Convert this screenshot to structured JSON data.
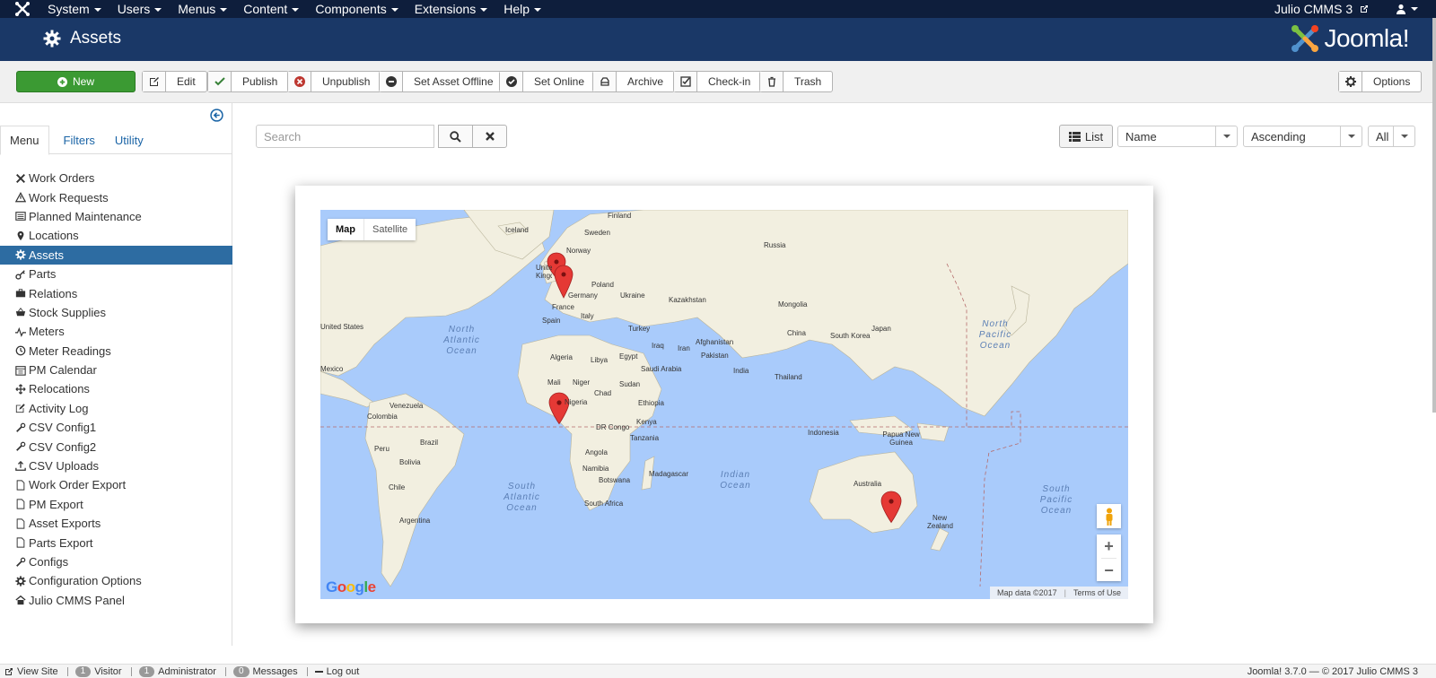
{
  "topbar": {
    "menu": [
      "System",
      "Users",
      "Menus",
      "Content",
      "Components",
      "Extensions",
      "Help"
    ],
    "site_link": "Julio CMMS 3"
  },
  "header": {
    "title": "Assets",
    "brand": "Joomla!"
  },
  "toolbar": {
    "new": "New",
    "edit": "Edit",
    "publish": "Publish",
    "unpublish": "Unpublish",
    "offline": "Set Asset Offline",
    "online": "Set Online",
    "archive": "Archive",
    "checkin": "Check-in",
    "trash": "Trash",
    "options": "Options"
  },
  "sidebar": {
    "tabs": [
      "Menu",
      "Filters",
      "Utility"
    ],
    "items": [
      {
        "label": "Work Orders",
        "icon": "tools-icon"
      },
      {
        "label": "Work Requests",
        "icon": "warning-icon"
      },
      {
        "label": "Planned Maintenance",
        "icon": "list-icon"
      },
      {
        "label": "Locations",
        "icon": "pin-icon"
      },
      {
        "label": "Assets",
        "icon": "gear-icon"
      },
      {
        "label": "Parts",
        "icon": "key-icon"
      },
      {
        "label": "Relations",
        "icon": "briefcase-icon"
      },
      {
        "label": "Stock Supplies",
        "icon": "basket-icon"
      },
      {
        "label": "Meters",
        "icon": "pulse-icon"
      },
      {
        "label": "Meter Readings",
        "icon": "clock-icon"
      },
      {
        "label": "PM Calendar",
        "icon": "calendar-icon"
      },
      {
        "label": "Relocations",
        "icon": "move-icon"
      },
      {
        "label": "Activity Log",
        "icon": "edit-icon"
      },
      {
        "label": "CSV Config1",
        "icon": "wrench-icon"
      },
      {
        "label": "CSV Config2",
        "icon": "wrench-icon"
      },
      {
        "label": "CSV Uploads",
        "icon": "upload-icon"
      },
      {
        "label": "Work Order Export",
        "icon": "file-icon"
      },
      {
        "label": "PM Export",
        "icon": "file-icon"
      },
      {
        "label": "Asset Exports",
        "icon": "file-icon"
      },
      {
        "label": "Parts Export",
        "icon": "file-icon"
      },
      {
        "label": "Configs",
        "icon": "wrench-icon"
      },
      {
        "label": "Configuration Options",
        "icon": "gear-icon"
      },
      {
        "label": "Julio CMMS Panel",
        "icon": "home-icon"
      }
    ],
    "active_index": 4
  },
  "search": {
    "placeholder": "Search"
  },
  "view": {
    "list_label": "List",
    "sort_field": "Name",
    "sort_dir": "Ascending",
    "limit": "All"
  },
  "map": {
    "type_map": "Map",
    "type_satellite": "Satellite",
    "attribution": "Map data ©2017",
    "terms": "Terms of Use",
    "google": "Google",
    "labels": {
      "iceland": "Iceland",
      "finland": "Finland",
      "sweden": "Sweden",
      "norway": "Norway",
      "russia": "Russia",
      "united_kingdom": "United Kingdom",
      "germany": "Germany",
      "poland": "Poland",
      "ukraine": "Ukraine",
      "kazakhstan": "Kazakhstan",
      "mongolia": "Mongolia",
      "france": "France",
      "italy": "Italy",
      "spain": "Spain",
      "turkey": "Turkey",
      "japan": "Japan",
      "china": "China",
      "south_korea": "South Korea",
      "united_states": "United States",
      "mexico": "Mexico",
      "afghanistan": "Afghanistan",
      "iraq": "Iraq",
      "iran": "Iran",
      "pakistan": "Pakistan",
      "algeria": "Algeria",
      "libya": "Libya",
      "egypt": "Egypt",
      "saudi_arabia": "Saudi Arabia",
      "india": "India",
      "thailand": "Thailand",
      "mali": "Mali",
      "niger": "Niger",
      "chad": "Chad",
      "sudan": "Sudan",
      "ethiopia": "Ethiopia",
      "nigeria": "Nigeria",
      "venezuela": "Venezuela",
      "colombia": "Colombia",
      "dr_congo": "DR Congo",
      "kenya": "Kenya",
      "indonesia": "Indonesia",
      "papua": "Papua New Guinea",
      "peru": "Peru",
      "brazil": "Brazil",
      "tanzania": "Tanzania",
      "bolivia": "Bolivia",
      "angola": "Angola",
      "namibia": "Namibia",
      "madagascar": "Madagascar",
      "chile": "Chile",
      "botswana": "Botswana",
      "south_africa": "South Africa",
      "australia": "Australia",
      "argentina": "Argentina",
      "new_zealand": "New Zealand",
      "north_atlantic": "North Atlantic Ocean",
      "north_pacific": "North Pacific Ocean",
      "south_atlantic": "South Atlantic Ocean",
      "indian_ocean": "Indian Ocean",
      "south_pacific": "South Pacific Ocean"
    }
  },
  "footer": {
    "view_site": "View Site",
    "visitor_count": "1",
    "visitor": "Visitor",
    "admin_count": "1",
    "admin": "Administrator",
    "messages_count": "0",
    "messages": "Messages",
    "logout": "Log out",
    "copyright": "Joomla! 3.7.0 — © 2017 Julio CMMS 3"
  },
  "colors": {
    "topbar": "#0e1e3c",
    "header": "#1a3867",
    "active_nav": "#2d6ca2",
    "new_button": "#3b9a33",
    "marker": "#e53935",
    "water": "#a9cbfb",
    "land": "#f0eddc"
  }
}
